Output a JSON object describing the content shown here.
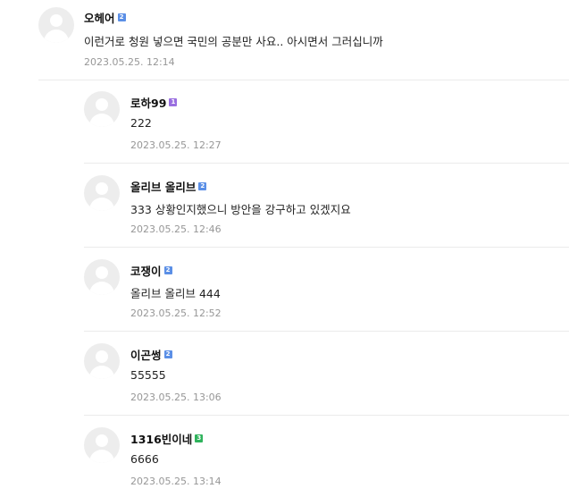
{
  "comments": [
    {
      "author": "오헤어",
      "level": "2",
      "level_color": "#5b8fe6",
      "text": "이런거로 청원 넣으면 국민의 공분만 사요.. 아시면서 그러십니까",
      "date": "2023.05.25. 12:14",
      "reply": false
    },
    {
      "author": "로하99",
      "level": "1",
      "level_color": "#9a6fe0",
      "text": "222",
      "date": "2023.05.25. 12:27",
      "reply": true
    },
    {
      "author": "올리브 올리브",
      "level": "2",
      "level_color": "#5b8fe6",
      "text": "333 상황인지했으니 방안을 강구하고 있겠지요",
      "date": "2023.05.25. 12:46",
      "reply": true
    },
    {
      "author": "코쟁이",
      "level": "2",
      "level_color": "#5b8fe6",
      "text": "올리브 올리브 444",
      "date": "2023.05.25. 12:52",
      "reply": true
    },
    {
      "author": "이곤썽",
      "level": "2",
      "level_color": "#5b8fe6",
      "text": "55555",
      "date": "2023.05.25. 13:06",
      "reply": true
    },
    {
      "author": "1316빈이네",
      "level": "3",
      "level_color": "#2fb35c",
      "text": "6666",
      "date": "2023.05.25. 13:14",
      "reply": true
    }
  ]
}
